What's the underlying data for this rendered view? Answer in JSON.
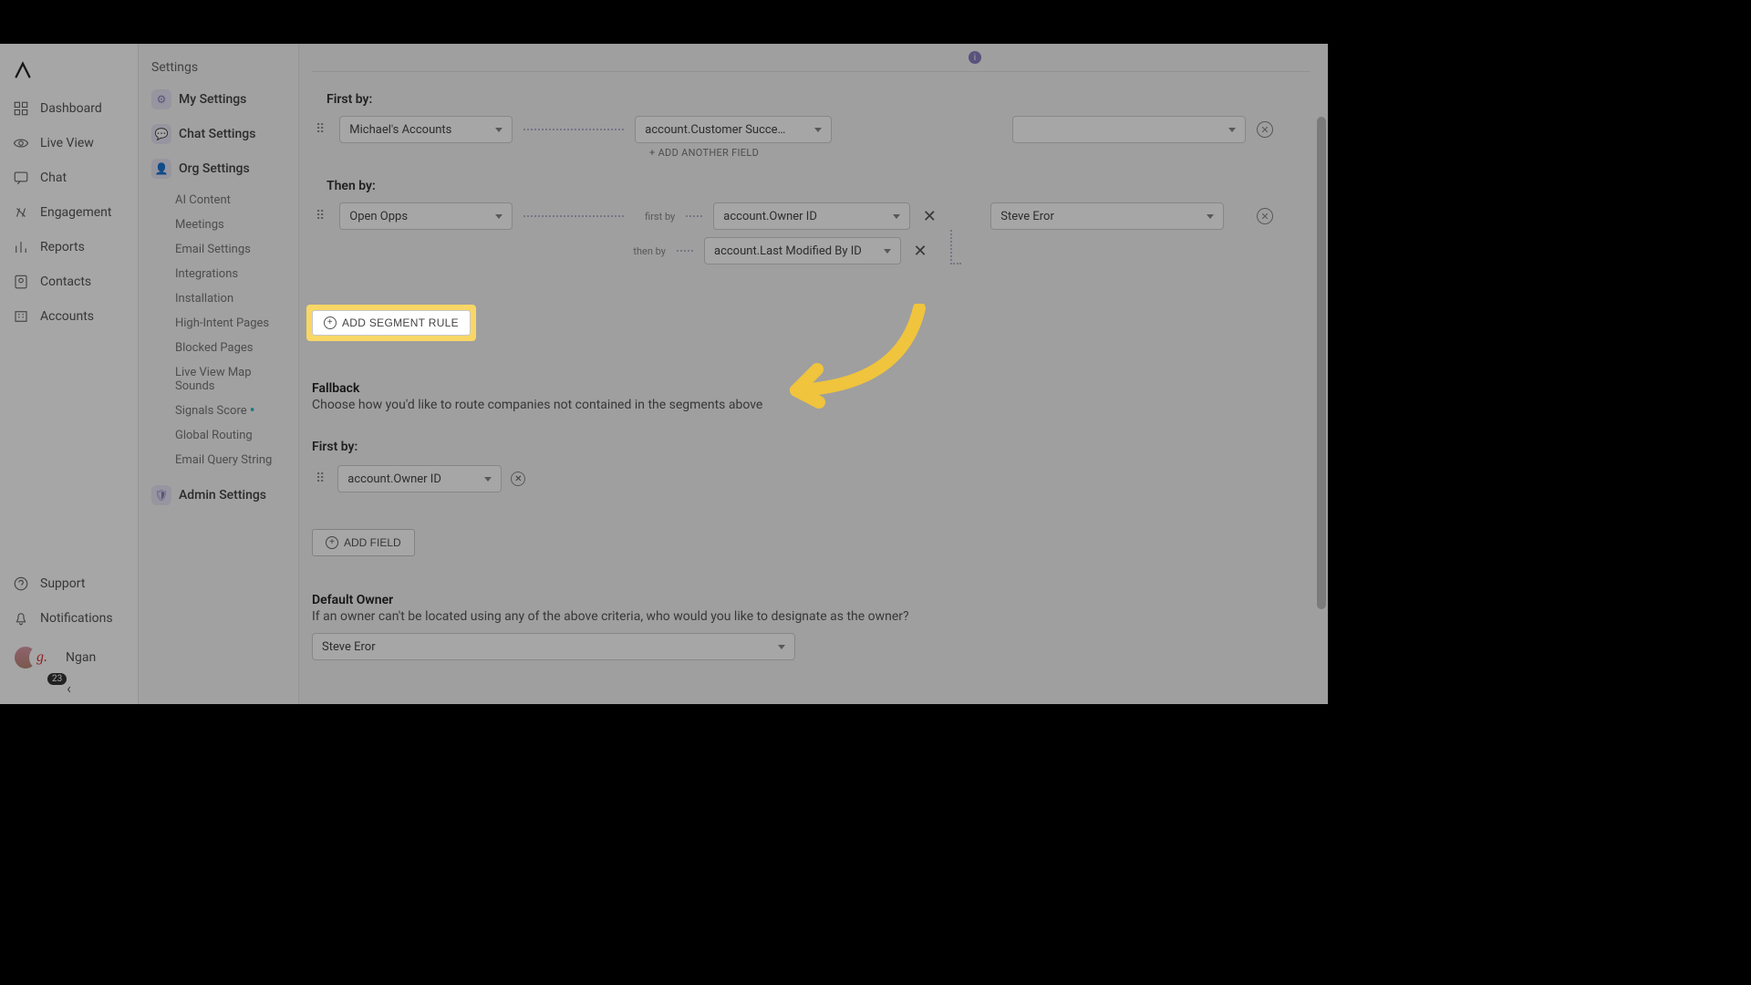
{
  "primary_nav": {
    "items": [
      {
        "label": "Dashboard"
      },
      {
        "label": "Live View"
      },
      {
        "label": "Chat"
      },
      {
        "label": "Engagement"
      },
      {
        "label": "Reports"
      },
      {
        "label": "Contacts"
      },
      {
        "label": "Accounts"
      }
    ],
    "support": "Support",
    "notifications": "Notifications",
    "user_name": "Ngan",
    "badge": "23",
    "g_char": "g."
  },
  "secondary_nav": {
    "title": "Settings",
    "groups": [
      {
        "icon": "gear",
        "label": "My Settings"
      },
      {
        "icon": "chat",
        "label": "Chat Settings"
      },
      {
        "icon": "org",
        "label": "Org Settings"
      }
    ],
    "org_subs": [
      {
        "label": "AI Content"
      },
      {
        "label": "Meetings"
      },
      {
        "label": "Email Settings"
      },
      {
        "label": "Integrations"
      },
      {
        "label": "Installation"
      },
      {
        "label": "High-Intent Pages"
      },
      {
        "label": "Blocked Pages"
      },
      {
        "label": "Live View Map Sounds"
      },
      {
        "label": "Signals Score",
        "new": true
      },
      {
        "label": "Global Routing"
      },
      {
        "label": "Email Query String"
      }
    ],
    "admin": {
      "label": "Admin Settings"
    }
  },
  "main": {
    "first_by_label": "First by:",
    "then_by_label": "Then by:",
    "rule1": {
      "segment": "Michael's Accounts",
      "field1": "account.Customer Succe…",
      "owner": "",
      "add_another": "+ ADD ANOTHER FIELD"
    },
    "rule2": {
      "segment": "Open Opps",
      "first_by": "first by",
      "then_by": "then by",
      "field1": "account.Owner ID",
      "field2": "account.Last Modified By ID",
      "owner": "Steve Eror"
    },
    "add_segment_rule": "ADD SEGMENT RULE",
    "fallback": {
      "title": "Fallback",
      "desc": "Choose how you'd like to route companies not contained in the segments above",
      "first_by": "First by:",
      "field": "account.Owner ID",
      "add_field": "ADD FIELD"
    },
    "default_owner": {
      "title": "Default Owner",
      "desc": "If an owner can't be located using any of the above criteria, who would you like to designate as the owner?",
      "value": "Steve Eror"
    }
  }
}
